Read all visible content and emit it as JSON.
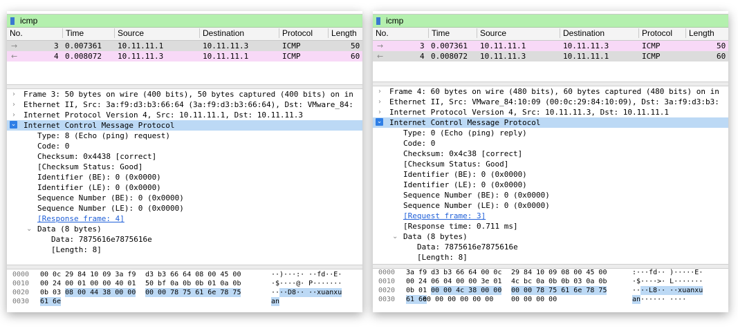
{
  "filter_text": "icmp",
  "columns": [
    "No.",
    "Time",
    "Source",
    "Destination",
    "Protocol",
    "Length"
  ],
  "left": {
    "packets": [
      {
        "no": "3",
        "time": "0.007361",
        "source": "10.11.11.1",
        "destination": "10.11.11.3",
        "protocol": "ICMP",
        "length": "50",
        "state": "selected"
      },
      {
        "no": "4",
        "time": "0.008072",
        "source": "10.11.11.3",
        "destination": "10.11.11.1",
        "protocol": "ICMP",
        "length": "60",
        "state": "pink"
      }
    ],
    "details": {
      "frame": "Frame 3: 50 bytes on wire (400 bits), 50 bytes captured (400 bits) on in",
      "ethernet": "Ethernet II, Src: 3a:f9:d3:b3:66:64 (3a:f9:d3:b3:66:64), Dst: VMware_84:",
      "ip": "Internet Protocol Version 4, Src: 10.11.11.1, Dst: 10.11.11.3",
      "icmp": "Internet Control Message Protocol",
      "type": "Type: 8 (Echo (ping) request)",
      "code": "Code: 0",
      "checksum": "Checksum: 0x4438 [correct]",
      "checksum_status": "[Checksum Status: Good]",
      "id_be": "Identifier (BE): 0 (0x0000)",
      "id_le": "Identifier (LE): 0 (0x0000)",
      "seq_be": "Sequence Number (BE): 0 (0x0000)",
      "seq_le": "Sequence Number (LE): 0 (0x0000)",
      "response_link": "[Response frame: 4]",
      "data_header": "Data (8 bytes)",
      "data_value": "Data: 7875616e7875616e",
      "data_length": "[Length: 8]"
    },
    "hex": [
      {
        "offset": "0000",
        "b1": "00 0c 29 84 10 09 3a f9",
        "b2": "d3 b3 66 64 08 00 45 00",
        "ascii": "··)···:· ··fd··E·"
      },
      {
        "offset": "0010",
        "b1": "00 24 00 01 00 00 40 01",
        "b2": "50 bf 0a 0b 0b 01 0a 0b",
        "ascii": "·$····@· P·······"
      },
      {
        "offset": "0020",
        "b1": "0b 03",
        "b1_hl": "08 00 44 38 00 00",
        "b2_hl": "00 00 78 75 61 6e 78 75",
        "ascii_pre": "··",
        "ascii_hl": "··D8·· ··xuanxu"
      },
      {
        "offset": "0030",
        "b1_hl": "61 6e",
        "ascii_hl": "an"
      }
    ]
  },
  "right": {
    "packets": [
      {
        "no": "3",
        "time": "0.007361",
        "source": "10.11.11.1",
        "destination": "10.11.11.3",
        "protocol": "ICMP",
        "length": "50",
        "state": "pink"
      },
      {
        "no": "4",
        "time": "0.008072",
        "source": "10.11.11.3",
        "destination": "10.11.11.1",
        "protocol": "ICMP",
        "length": "60",
        "state": "selected"
      }
    ],
    "details": {
      "frame": "Frame 4: 60 bytes on wire (480 bits), 60 bytes captured (480 bits) on in",
      "ethernet": "Ethernet II, Src: VMware_84:10:09 (00:0c:29:84:10:09), Dst: 3a:f9:d3:b3:",
      "ip": "Internet Protocol Version 4, Src: 10.11.11.3, Dst: 10.11.11.1",
      "icmp": "Internet Control Message Protocol",
      "type": "Type: 0 (Echo (ping) reply)",
      "code": "Code: 0",
      "checksum": "Checksum: 0x4c38 [correct]",
      "checksum_status": "[Checksum Status: Good]",
      "id_be": "Identifier (BE): 0 (0x0000)",
      "id_le": "Identifier (LE): 0 (0x0000)",
      "seq_be": "Sequence Number (BE): 0 (0x0000)",
      "seq_le": "Sequence Number (LE): 0 (0x0000)",
      "request_link": "[Request frame: 3]",
      "response_time": "[Response time: 0.711 ms]",
      "data_header": "Data (8 bytes)",
      "data_value": "Data: 7875616e7875616e",
      "data_length": "[Length: 8]"
    },
    "hex": [
      {
        "offset": "0000",
        "b1": "3a f9 d3 b3 66 64 00 0c",
        "b2": "29 84 10 09 08 00 45 00",
        "ascii": ":···fd·· )·····E·"
      },
      {
        "offset": "0010",
        "b1": "00 24 06 04 00 00 3e 01",
        "b2": "4c bc 0a 0b 0b 03 0a 0b",
        "ascii": "·$····>· L·······"
      },
      {
        "offset": "0020",
        "b1": "0b 01",
        "b1_hl": "00 00 4c 38 00 00",
        "b2_hl": "00 00 78 75 61 6e 78 75",
        "ascii_pre": "··",
        "ascii_hl": "··L8·· ··xuanxu"
      },
      {
        "offset": "0030",
        "b1_hl": "61 6e",
        "b1_rest": "00 00 00 00 00 00",
        "b2": "00 00 00 00",
        "ascii_hl": "an",
        "ascii_rest": "······ ····"
      }
    ]
  }
}
